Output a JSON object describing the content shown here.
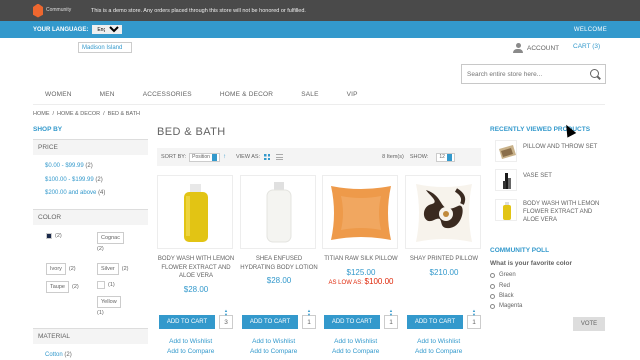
{
  "demo_notice": {
    "logo_text": "Community",
    "message": "This is a demo store. Any orders placed through this store will not be honored or fulfilled."
  },
  "top_bar": {
    "language_label": "YOUR LANGUAGE:",
    "language_value": "English",
    "welcome": "WELCOME"
  },
  "header": {
    "logo_alt": "Madison Island",
    "account": "ACCOUNT",
    "cart": "CART (3)",
    "search_placeholder": "Search entire store here..."
  },
  "nav": [
    "WOMEN",
    "MEN",
    "ACCESSORIES",
    "HOME & DECOR",
    "SALE",
    "VIP"
  ],
  "breadcrumb": [
    "HOME",
    "HOME & DECOR",
    "BED & BATH"
  ],
  "sidebar": {
    "shop_by": "SHOP BY",
    "price_label": "PRICE",
    "price_filters": [
      {
        "label": "$0.00 - $99.99",
        "count": "(2)"
      },
      {
        "label": "$100.00 - $199.99",
        "count": "(2)"
      },
      {
        "label": "$200.00 and above",
        "count": "(4)"
      }
    ],
    "color_label": "COLOR",
    "colors": [
      {
        "label": "",
        "count": "(2)"
      },
      {
        "label": "Cognac",
        "count": "(2)"
      },
      {
        "label": "Ivory",
        "count": "(2)"
      },
      {
        "label": "Silver",
        "count": "(2)"
      },
      {
        "label": "Taupe",
        "count": "(2)"
      },
      {
        "label": "",
        "count": "(1)"
      },
      {
        "label": "Yellow",
        "count": "(1)"
      }
    ],
    "material_label": "MATERIAL",
    "material_first": {
      "label": "Cotton",
      "count": "(2)"
    }
  },
  "main": {
    "title": "BED & BATH",
    "sort_by_label": "SORT BY:",
    "sort_by_value": "Position",
    "view_as_label": "VIEW AS:",
    "items_count": "8 Item(s)",
    "show_label": "SHOW:",
    "show_value": "12",
    "add_to_cart": "ADD TO CART",
    "add_to_wishlist": "Add to Wishlist",
    "add_to_compare": "Add to Compare",
    "products": [
      {
        "name": "BODY WASH WITH LEMON FLOWER EXTRACT AND ALOE VERA",
        "price": "$28.00",
        "qty": "3",
        "as_low": ""
      },
      {
        "name": "SHEA ENFUSED HYDRATING BODY LOTION",
        "price": "$28.00",
        "qty": "1",
        "as_low": ""
      },
      {
        "name": "TITIAN RAW SILK PILLOW",
        "price": "$125.00",
        "qty": "1",
        "as_low_label": "AS LOW AS:",
        "as_low": "$100.00"
      },
      {
        "name": "SHAY PRINTED PILLOW",
        "price": "$210.00",
        "qty": "1",
        "as_low": ""
      }
    ]
  },
  "right": {
    "recent_title": "RECENTLY VIEWED PRODUCTS",
    "recent_items": [
      "PILLOW AND THROW SET",
      "VASE SET",
      "BODY WASH WITH LEMON FLOWER EXTRACT AND ALOE VERA"
    ],
    "poll_title": "COMMUNITY POLL",
    "poll_question": "What is your favorite color",
    "poll_options": [
      "Green",
      "Red",
      "Black",
      "Magenta"
    ],
    "vote": "VOTE"
  }
}
